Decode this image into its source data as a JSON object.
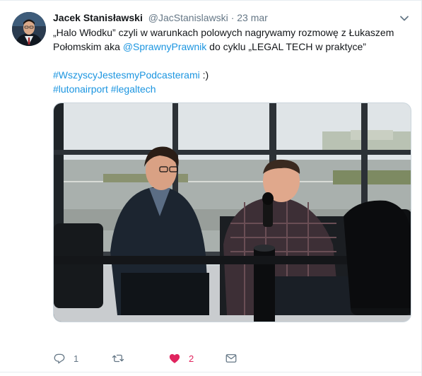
{
  "tweet": {
    "author_name": "Jacek Stanisławski",
    "author_handle": "@JacStanislawski",
    "separator": "·",
    "date": "23 mar",
    "text_line1": "„Halo Włodku” czyli w warunkach polowych nagrywamy rozmowę z Łukaszem",
    "text_line2_prefix": "Połomskim aka ",
    "mention": "@SprawnyPrawnik",
    "text_line2_suffix": " do cyklu „LEGAL TECH w praktyce”",
    "hashtag1": "#WszyscyJestesmyPodcasterami",
    "hashtag1_suffix": " :)",
    "hashtag2": "#lutonairport",
    "hashtag3": "#legaltech"
  },
  "actions": {
    "reply_count": "1",
    "retweet_count": "",
    "like_count": "2",
    "message_count": ""
  },
  "icons": {
    "caret": "chevron-down-icon",
    "reply": "reply-icon",
    "retweet": "retweet-icon",
    "like": "heart-icon",
    "message": "envelope-icon"
  },
  "colors": {
    "link": "#1b95e0",
    "muted": "#657786",
    "like": "#e0245e",
    "text": "#14171a"
  }
}
